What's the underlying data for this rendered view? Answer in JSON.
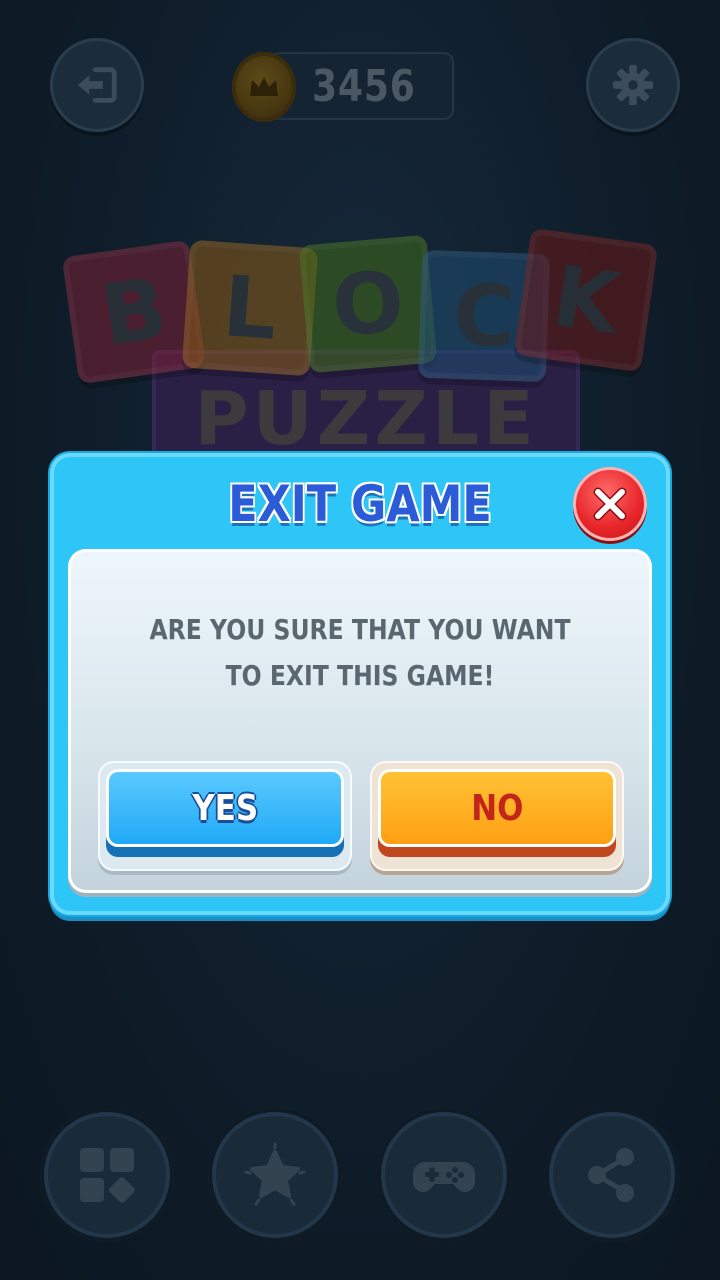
{
  "top_bar": {
    "coins": "3456",
    "icons": {
      "back": "exit-door-icon",
      "settings": "gear-icon",
      "coin": "crown-coin-icon"
    }
  },
  "logo": {
    "tiles": [
      {
        "letter": "B",
        "color": "#7a1f33"
      },
      {
        "letter": "L",
        "color": "#8a5a14"
      },
      {
        "letter": "O",
        "color": "#3f6a17"
      },
      {
        "letter": "C",
        "color": "#1f4d72"
      },
      {
        "letter": "K",
        "color": "#6a1818"
      }
    ],
    "subtitle": "PUZZLE"
  },
  "dialog": {
    "title": "EXIT GAME",
    "message": "ARE YOU SURE THAT YOU WANT TO EXIT THIS GAME!",
    "yes_label": "YES",
    "no_label": "NO",
    "colors": {
      "frame": "#2ec6f7",
      "title": "#2b5bd6",
      "yes": "#1ea8f5",
      "no": "#ffb020",
      "close": "#e8262a"
    }
  },
  "bottom_nav": {
    "icons": [
      "blocks-icon",
      "star-icon",
      "gamepad-icon",
      "share-icon"
    ]
  }
}
